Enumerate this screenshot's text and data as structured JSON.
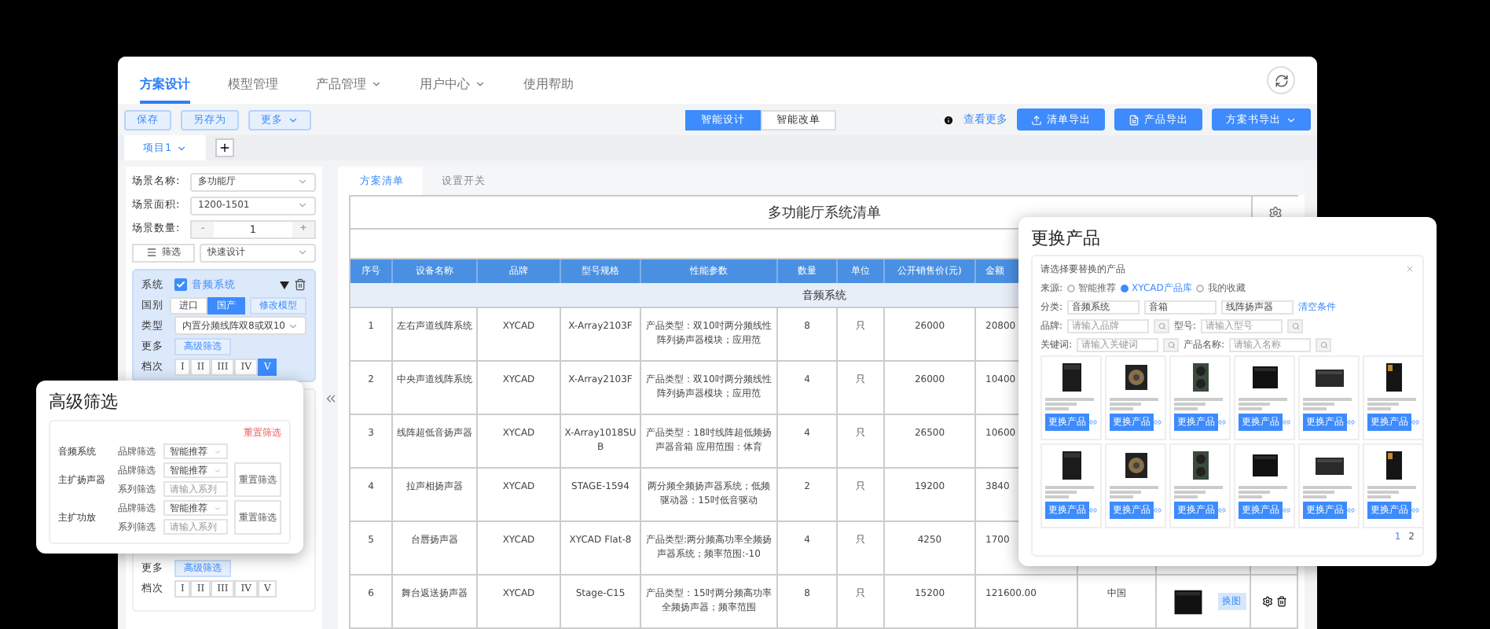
{
  "nav": {
    "tabs": [
      {
        "label": "方案设计",
        "selected": true,
        "has_menu": false
      },
      {
        "label": "模型管理",
        "selected": false,
        "has_menu": false
      },
      {
        "label": "产品管理",
        "selected": false,
        "has_menu": true
      },
      {
        "label": "用户中心",
        "selected": false,
        "has_menu": true
      },
      {
        "label": "使用帮助",
        "selected": false,
        "has_menu": false
      }
    ]
  },
  "toolbar": {
    "left_buttons": [
      {
        "label": "保存",
        "has_menu": false
      },
      {
        "label": "另存为",
        "has_menu": false
      },
      {
        "label": "更多",
        "has_menu": true
      }
    ],
    "mode_switch": [
      {
        "label": "智能设计",
        "selected": true
      },
      {
        "label": "智能改单",
        "selected": false
      }
    ],
    "help_link": "查看更多",
    "right_buttons": [
      {
        "label": "清单导出",
        "has_menu": false
      },
      {
        "label": "产品导出",
        "has_menu": false
      },
      {
        "label": "方案书导出",
        "has_menu": true
      }
    ]
  },
  "project_tabs": [
    {
      "label": "项目1",
      "selected": true
    }
  ],
  "scene_form": {
    "fields": [
      {
        "kind": "select",
        "label": "场景名称:",
        "value": "多功能厅"
      },
      {
        "kind": "select",
        "label": "场景面积:",
        "value": "1200-1501"
      },
      {
        "kind": "stepper",
        "label": "场景数量:",
        "value": "1",
        "minus": "-",
        "plus": "+"
      }
    ],
    "filter_button": "筛选",
    "quick_design": "快速设计"
  },
  "system_cards": [
    {
      "rows": [
        {
          "kind": "system",
          "label": "系统",
          "checked": true,
          "value": "音频系统"
        },
        {
          "kind": "origin",
          "label": "国别",
          "options": [
            {
              "label": "进口",
              "selected": false
            },
            {
              "label": "国产",
              "selected": true
            }
          ],
          "action": "修改模型"
        },
        {
          "kind": "select",
          "label": "类型",
          "value": "内置分频线阵双8或双10"
        },
        {
          "kind": "more",
          "label": "更多",
          "action": "高级筛选"
        },
        {
          "kind": "grade",
          "label": "档次",
          "options": [
            {
              "label": "I",
              "selected": false
            },
            {
              "label": "II",
              "selected": false
            },
            {
              "label": "III",
              "selected": false
            },
            {
              "label": "IV",
              "selected": false
            },
            {
              "label": "V",
              "selected": true
            }
          ]
        }
      ]
    },
    {
      "rows": [
        {
          "kind": "more",
          "label": "更多",
          "action": "高级筛选"
        },
        {
          "kind": "grade",
          "label": "档次",
          "options": [
            {
              "label": "I",
              "selected": false
            },
            {
              "label": "II",
              "selected": false
            },
            {
              "label": "III",
              "selected": false
            },
            {
              "label": "IV",
              "selected": false
            },
            {
              "label": "V",
              "selected": false
            }
          ]
        }
      ]
    }
  ],
  "content_tabs": [
    {
      "label": "方案清单",
      "selected": true
    },
    {
      "label": "设置开关",
      "selected": false
    }
  ],
  "table": {
    "title": "多功能厅系统清单",
    "columns": [
      "序号",
      "设备名称",
      "品牌",
      "型号规格",
      "性能参数",
      "数量",
      "单位",
      "公开销售价(元)",
      "金额"
    ],
    "section": "音频系统",
    "rows": [
      {
        "cells": [
          "1",
          "左右声道线阵系统",
          "XYCAD",
          "X-Array2103F",
          "产品类型：双10吋两分频线性阵列扬声器模块；应用范",
          "8",
          "只",
          "26000",
          "20800"
        ]
      },
      {
        "cells": [
          "2",
          "中央声道线阵系统",
          "XYCAD",
          "X-Array2103F",
          "产品类型：双10吋两分频线性阵列扬声器模块；应用范",
          "4",
          "只",
          "26000",
          "10400"
        ]
      },
      {
        "cells": [
          "3",
          "线阵超低音扬声器",
          "XYCAD",
          "X-Array1018SUB",
          "产品类型：18吋线阵超低频扬声器音箱 应用范围：体育",
          "4",
          "只",
          "26500",
          "10600"
        ]
      },
      {
        "cells": [
          "4",
          "拉声相扬声器",
          "XYCAD",
          "STAGE-1594",
          "两分频全频扬声器系统；低频驱动器：15吋低音驱动",
          "2",
          "只",
          "19200",
          "3840"
        ]
      },
      {
        "cells": [
          "5",
          "台唇扬声器",
          "XYCAD",
          "XYCAD Flat-8",
          "产品类型:两分频高功率全频扬声器系统；频率范围:-10",
          "4",
          "只",
          "4250",
          "1700"
        ]
      },
      {
        "cells": [
          "6",
          "舞台返送扬声器",
          "XYCAD",
          "Stage-C15",
          "产品类型：15吋两分频高功率全频扬声器；频率范围",
          "8",
          "只",
          "15200",
          "121600.00"
        ],
        "origin": "中国",
        "image_tag": "换图"
      }
    ]
  },
  "advanced_filter": {
    "title": "高级筛选",
    "reset_all": "重置筛选",
    "groups": [
      {
        "name": "音频系统",
        "fields": [
          {
            "kind": "select",
            "label": "品牌筛选",
            "value": "智能推荐"
          }
        ]
      },
      {
        "name": "主扩扬声器",
        "fields": [
          {
            "kind": "select",
            "label": "品牌筛选",
            "value": "智能推荐"
          },
          {
            "kind": "input",
            "label": "系列筛选",
            "placeholder": "请输入系列"
          }
        ],
        "reset": "重置筛选"
      },
      {
        "name": "主扩功放",
        "fields": [
          {
            "kind": "select",
            "label": "品牌筛选",
            "value": "智能推荐"
          },
          {
            "kind": "input",
            "label": "系列筛选",
            "placeholder": "请输入系列"
          }
        ],
        "reset": "重置筛选"
      }
    ]
  },
  "replace_product": {
    "title": "更换产品",
    "subtitle": "请选择要替换的产品",
    "source": {
      "label": "来源:",
      "options": [
        {
          "label": "智能推荐",
          "selected": false
        },
        {
          "label": "XYCAD产品库",
          "selected": true
        },
        {
          "label": "我的收藏",
          "selected": false
        }
      ]
    },
    "category": {
      "label": "分类:",
      "values": [
        "音频系统",
        "音箱",
        "线阵扬声器"
      ],
      "clear": "清空条件"
    },
    "searches": [
      {
        "label": "品牌:",
        "placeholder": "请输入品牌"
      },
      {
        "label": "型号:",
        "placeholder": "请输入型号"
      },
      {
        "label": "关键词:",
        "placeholder": "请输入关键词"
      },
      {
        "label": "产品名称:",
        "placeholder": "请输入名称"
      }
    ],
    "products": [
      {
        "button": "更换产品"
      },
      {
        "button": "更换产品"
      },
      {
        "button": "更换产品"
      },
      {
        "button": "更换产品"
      },
      {
        "button": "更换产品"
      },
      {
        "button": "更换产品"
      },
      {
        "button": "更换产品"
      },
      {
        "button": "更换产品"
      },
      {
        "button": "更换产品"
      },
      {
        "button": "更换产品"
      },
      {
        "button": "更换产品"
      },
      {
        "button": "更换产品"
      }
    ],
    "pages": [
      {
        "label": "1",
        "selected": true
      },
      {
        "label": "2",
        "selected": false
      }
    ]
  }
}
